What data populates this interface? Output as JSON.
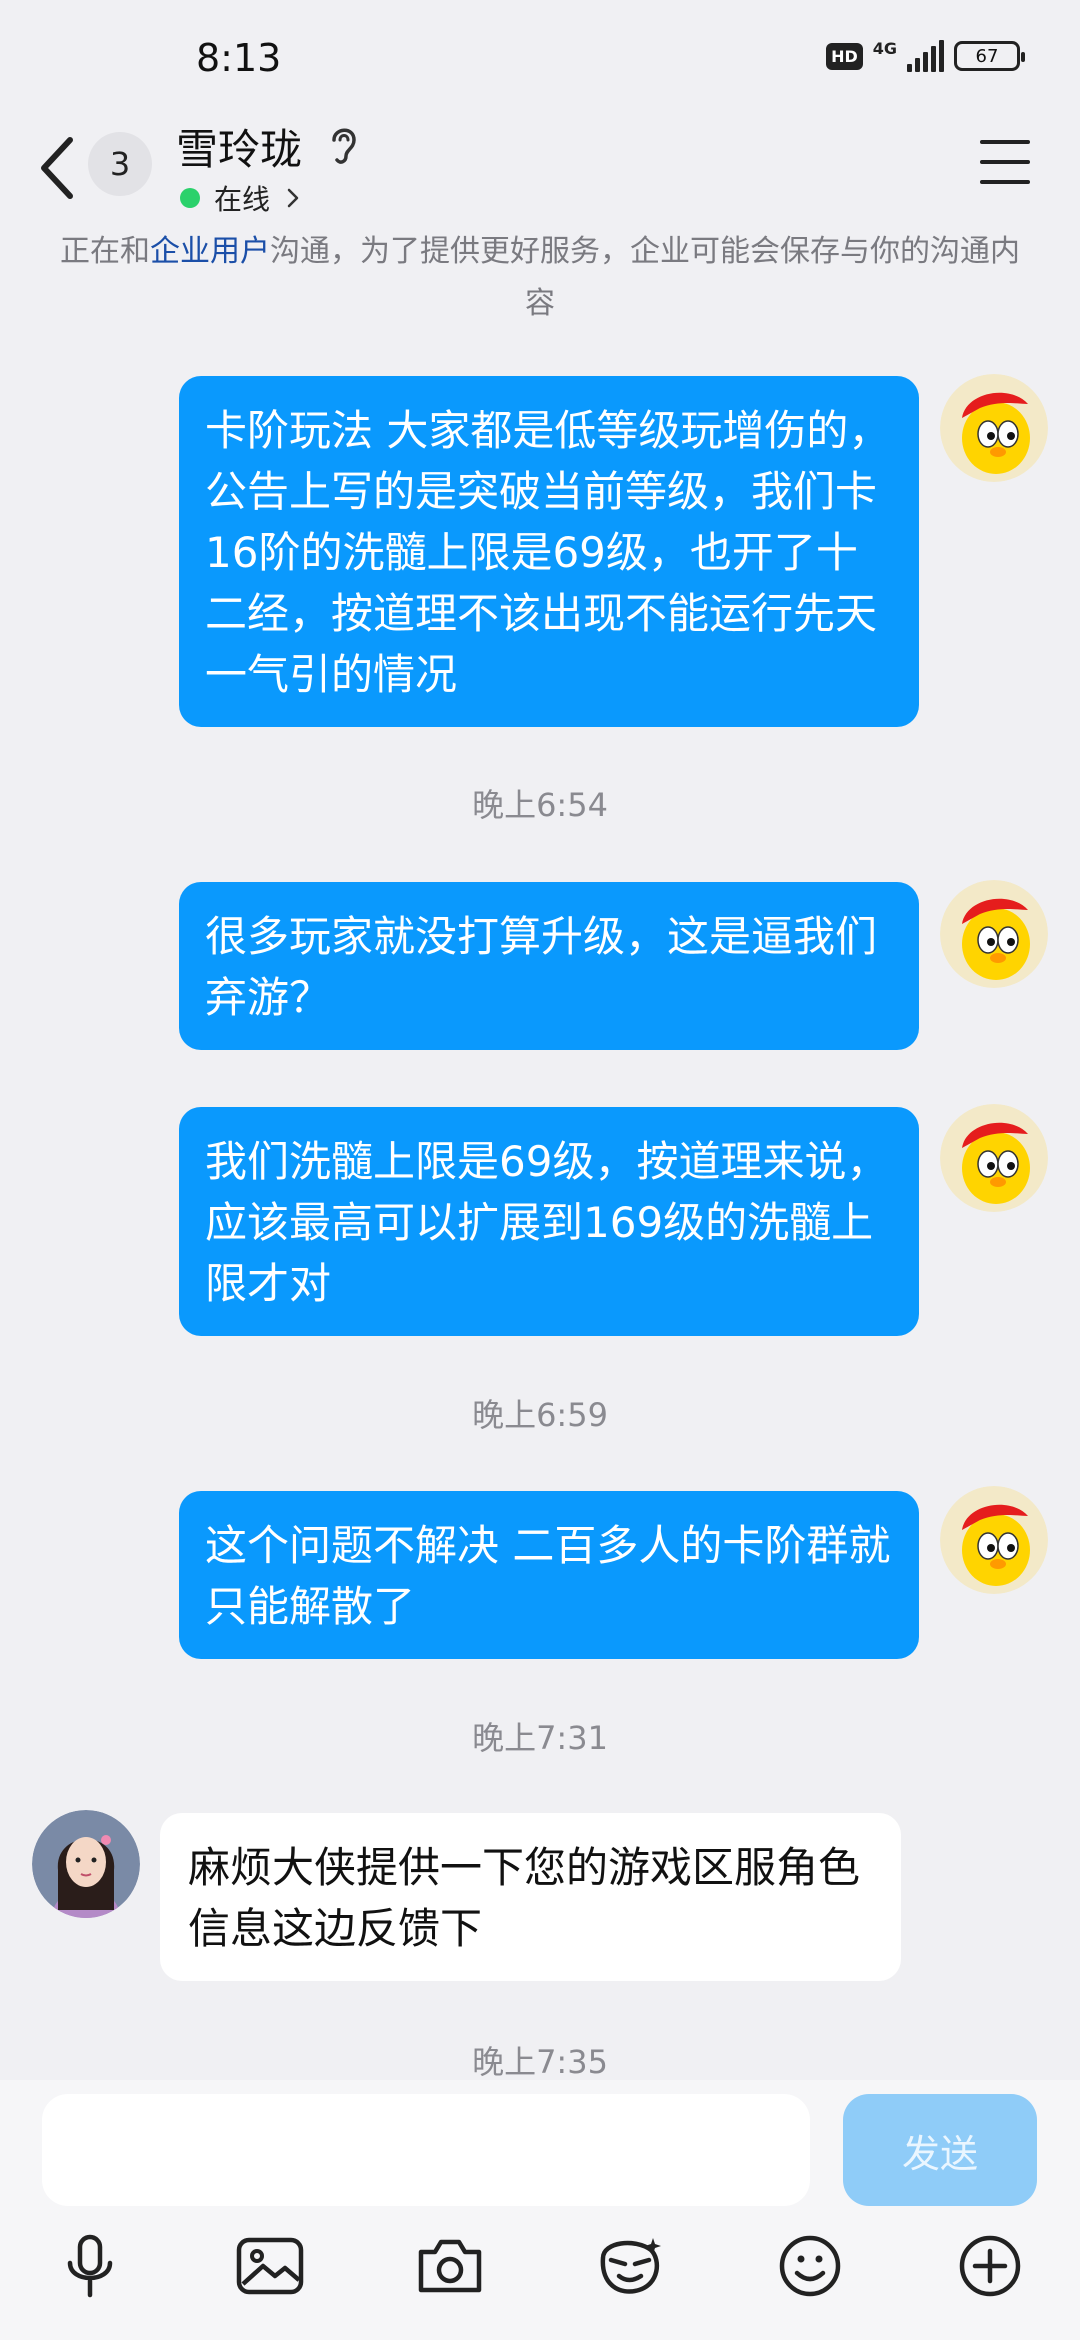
{
  "status_bar": {
    "time": "8:13",
    "hd": "HD",
    "network": "4G",
    "battery": "67"
  },
  "header": {
    "unread_count": "3",
    "contact_name": "雪玲珑",
    "presence": "在线"
  },
  "notice": {
    "prefix": "正在和",
    "link": "企业用户",
    "suffix": "沟通，为了提供更好服务，企业可能会保存与你的沟通内容"
  },
  "messages": [
    {
      "direction": "out",
      "text": "卡阶玩法  大家都是低等级玩增伤的，公告上写的是突破当前等级，我们卡16阶的洗髓上限是69级，也开了十二经，按道理不该出现不能运行先天一气引的情况"
    },
    {
      "direction": "out",
      "text": "很多玩家就没打算升级，这是逼我们弃游？"
    },
    {
      "direction": "out",
      "text": "我们洗髓上限是69级，按道理来说，应该最高可以扩展到169级的洗髓上限才对"
    },
    {
      "direction": "out",
      "text": "这个问题不解决  二百多人的卡阶群就只能解散了"
    },
    {
      "direction": "in",
      "text": "麻烦大侠提供一下您的游戏区服角色信息这边反馈下"
    }
  ],
  "timestamps": [
    "晚上6:54",
    "晚上6:59",
    "晚上7:31",
    "晚上7:35"
  ],
  "composer": {
    "placeholder": "",
    "send_label": "发送"
  },
  "colors": {
    "outgoing_bubble": "#0a99fd",
    "incoming_bubble": "#ffffff",
    "send_disabled": "#8fccf8",
    "online": "#2bd16b",
    "link": "#1b4fa8"
  },
  "toolbar_icons": [
    "microphone-icon",
    "image-icon",
    "camera-icon",
    "emoticon-face-icon",
    "smiley-icon",
    "plus-circle-icon"
  ]
}
